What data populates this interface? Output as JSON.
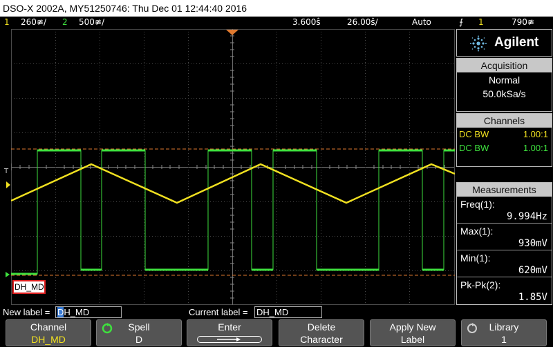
{
  "title_bar": "DSO-X 2002A, MY51250746: Thu Dec 01 12:44:40 2016",
  "status": {
    "ch1_num": "1",
    "ch1_scale": "260≇/",
    "ch2_num": "2",
    "ch2_scale": "500≇/",
    "delay": "3.600ŝ",
    "timebase": "26.00ŝ/",
    "trigger_mode": "Auto",
    "trigger_src": "1",
    "trigger_level": "790≇",
    "trigger_icon": "trigger-edge-icon"
  },
  "display": {
    "marker_t": "T",
    "label_text": "DH_MD",
    "colors": {
      "ch1": "#f0e020",
      "ch2": "#3ee03e",
      "grid": "#5a5a5a",
      "cursor": "#e07a30"
    }
  },
  "panel": {
    "brand": "Agilent",
    "acquisition_head": "Acquisition",
    "acq_mode": "Normal",
    "acq_rate": "50.0kSa/s",
    "channels_head": "Channels",
    "ch1_coupling": "DC BW",
    "ch1_probe": "1.00:1",
    "ch2_coupling": "DC BW",
    "ch2_probe": "1.00:1",
    "measurements_head": "Measurements",
    "measurements": [
      {
        "name": "Freq(1):",
        "value": "9.994Hz"
      },
      {
        "name": "Max(1):",
        "value": "930mV"
      },
      {
        "name": "Min(1):",
        "value": "620mV"
      },
      {
        "name": "Pk-Pk(2):",
        "value": "1.85V"
      }
    ]
  },
  "edit_row": {
    "new_label_caption": "New label =",
    "new_label_cursor": "D",
    "new_label_rest": "H_MD",
    "current_label_caption": "Current label =",
    "current_label_value": "DH_MD"
  },
  "softkeys": [
    {
      "label": "Channel",
      "value": "DH_MD"
    },
    {
      "label": "Spell",
      "value": "D"
    },
    {
      "label": "Enter",
      "value": ""
    },
    {
      "label": "Delete",
      "value": "Character"
    },
    {
      "label": "Apply New",
      "value": "Label"
    },
    {
      "label": "Library",
      "value": "1"
    }
  ]
}
